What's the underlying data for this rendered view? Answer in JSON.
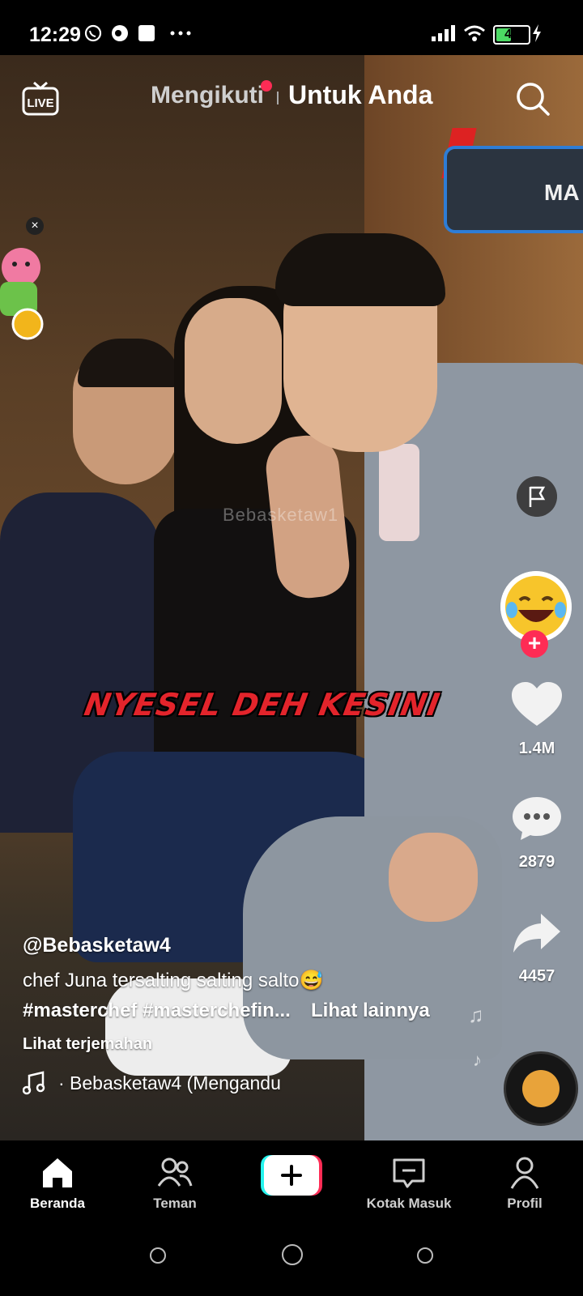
{
  "status_bar": {
    "time": "12:29",
    "battery": "42"
  },
  "top_nav": {
    "tab_following": "Mengikuti",
    "tab_for_you": "Untuk Anda"
  },
  "video": {
    "overlay_caption": "NYESEL DEH KESINI",
    "watermark": "Bebasketaw1",
    "sign_text": "MA"
  },
  "side_actions": {
    "likes": "1.4M",
    "comments": "2879",
    "shares": "4457"
  },
  "post": {
    "author": "@Bebasketaw4",
    "description_line1": "chef Juna tersalting salting salto😅",
    "description_line2": "#masterchef #masterchefin...",
    "see_more": "Lihat lainnya",
    "translate": "Lihat terjemahan",
    "music": "· Bebasketaw4 (Mengandu"
  },
  "bottom_nav": {
    "home": "Beranda",
    "friends": "Teman",
    "inbox": "Kotak Masuk",
    "profile": "Profil"
  },
  "colors": {
    "accent": "#fe2c55",
    "cyan": "#25f4ee",
    "caption_red": "#e3242b"
  }
}
